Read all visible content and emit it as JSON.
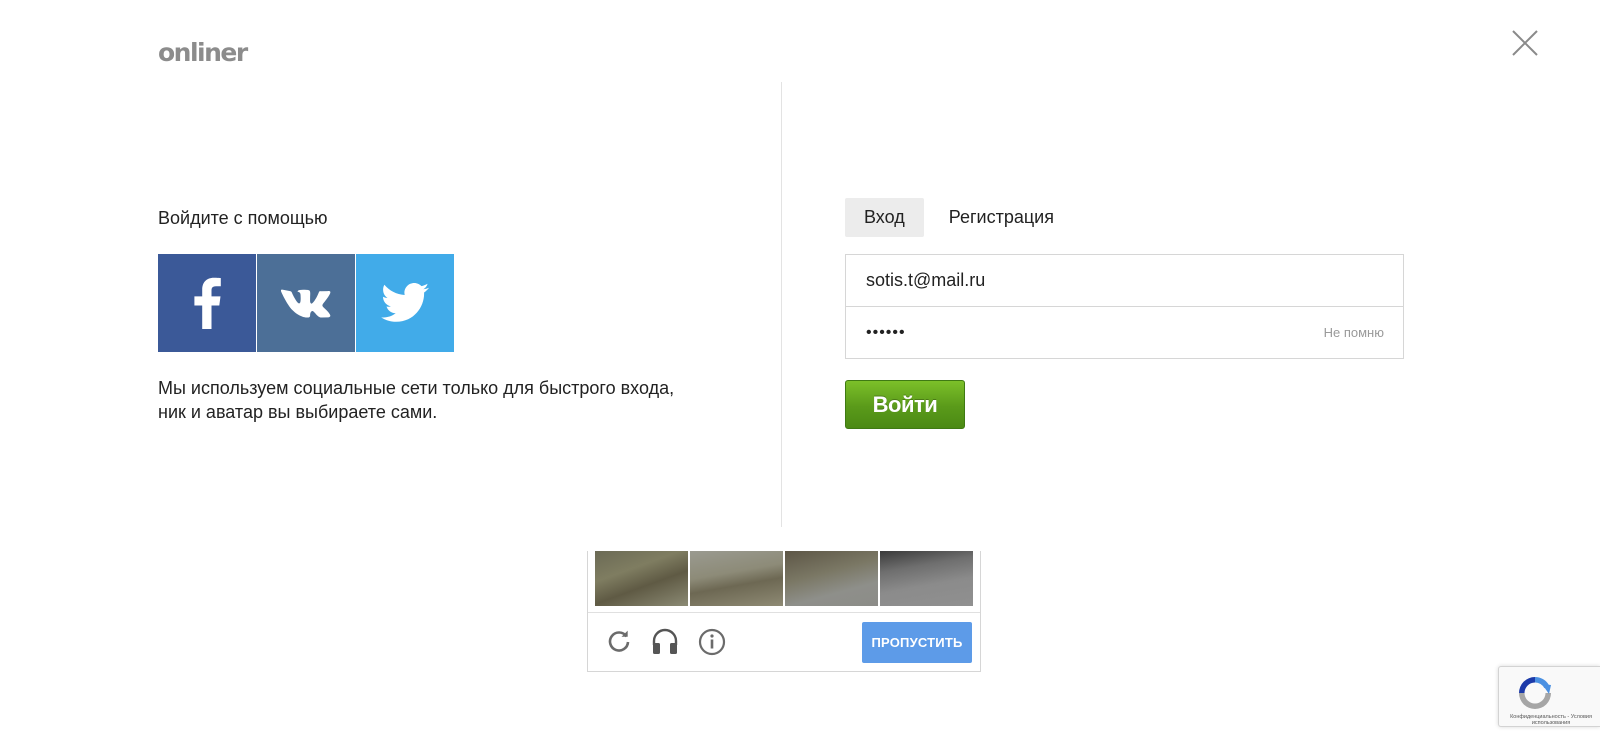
{
  "header": {
    "logo": "onliner"
  },
  "social": {
    "title": "Войдите с помощью",
    "providers": [
      "facebook",
      "vkontakte",
      "twitter"
    ],
    "note": "Мы используем социальные сети только для быстрого входа, ник и аватар вы выбираете сами."
  },
  "tabs": [
    {
      "label": "Вход",
      "active": true
    },
    {
      "label": "Регистрация",
      "active": false
    }
  ],
  "form": {
    "email_value": "sotis.t@mail.ru",
    "password_value": "••••••",
    "forgot_label": "Не помню",
    "submit_label": "Войти"
  },
  "captcha": {
    "skip_label": "ПРОПУСТИТЬ",
    "icons": [
      "reload-icon",
      "audio-icon",
      "info-icon"
    ]
  },
  "recaptcha": {
    "footer_text": "Конфиденциальность - Условия использования"
  },
  "colors": {
    "facebook": "#3b5998",
    "vkontakte": "#4c6f97",
    "twitter": "#41abe9",
    "submit_green": "#5a9a1a",
    "skip_blue": "#5d9be8"
  }
}
